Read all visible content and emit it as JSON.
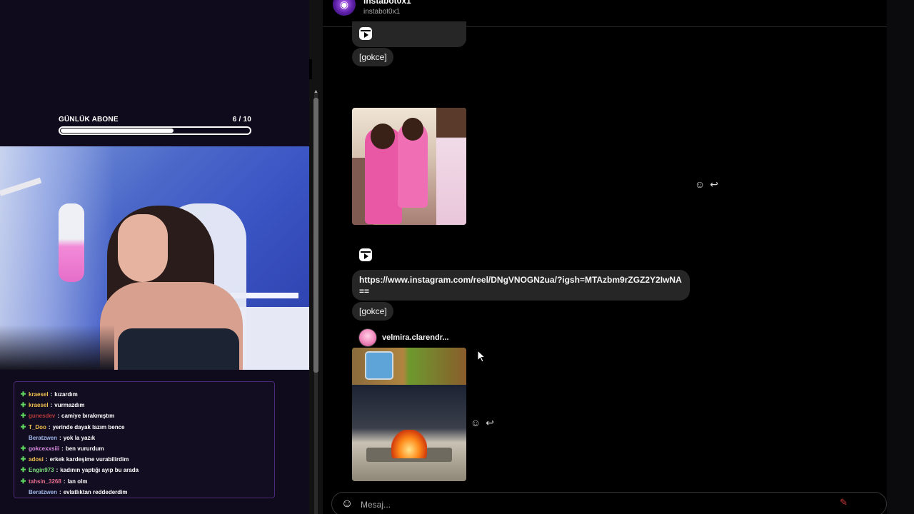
{
  "sub_goal": {
    "label": "GÜNLÜK ABONE",
    "current": "6",
    "sep": " / ",
    "target": "10",
    "progress": 0.6
  },
  "chat": {
    "lines": [
      {
        "user": "kraesel",
        "color": "#f2c14e",
        "text": "kızardım",
        "badge": true
      },
      {
        "user": "kraesel",
        "color": "#f2c14e",
        "text": "vurmazdım",
        "badge": true
      },
      {
        "user": "gunesdev",
        "color": "#b33a3a",
        "text": "camiye bırakmıştım",
        "badge": true
      },
      {
        "user": "T_Doo",
        "color": "#f2c14e",
        "text": "yerinde dayak lazım bence",
        "badge": true
      },
      {
        "user": "Beratzwen",
        "color": "#9fb7e8",
        "text": "yok la yazık",
        "badge": false
      },
      {
        "user": "gokcexxsiii",
        "color": "#d78be0",
        "text": "ben vururdum",
        "badge": true
      },
      {
        "user": "adosi",
        "color": "#f2c14e",
        "text": "erkek kardeşime vurabilirdim",
        "badge": true
      },
      {
        "user": "Engin973",
        "color": "#7be07b",
        "text": "kadının yaptığı ayıp bu arada",
        "badge": true
      },
      {
        "user": "tahsin_3268",
        "color": "#e86f8f",
        "text": "lan olm",
        "badge": true
      },
      {
        "user": "Beratzwen",
        "color": "#9fb7e8",
        "text": "evlatlıktan reddederdim",
        "badge": false
      }
    ]
  },
  "dm": {
    "name": "instabot0x1",
    "username": "instabot0x1",
    "messages": {
      "tag1": "[gokce]",
      "link": "https://www.instagram.com/reel/DNgVNOGN2ua/?igsh=MTAzbm9rZGZ2Y2IwNA==",
      "tag2": "[gokce]",
      "sender": "velmira.clarendr..."
    },
    "composer_placeholder": "Mesaj..."
  },
  "icons": {
    "react": "smile-icon",
    "reply": "reply-icon",
    "reel": "reel-icon",
    "emoji": "emoji-icon",
    "scroll_up": "scroll-up-icon"
  },
  "colors": {
    "accent": "#8a3ffc",
    "bubble": "#262626",
    "chat_border": "#4a2a78",
    "badge": "#5ed65e"
  }
}
